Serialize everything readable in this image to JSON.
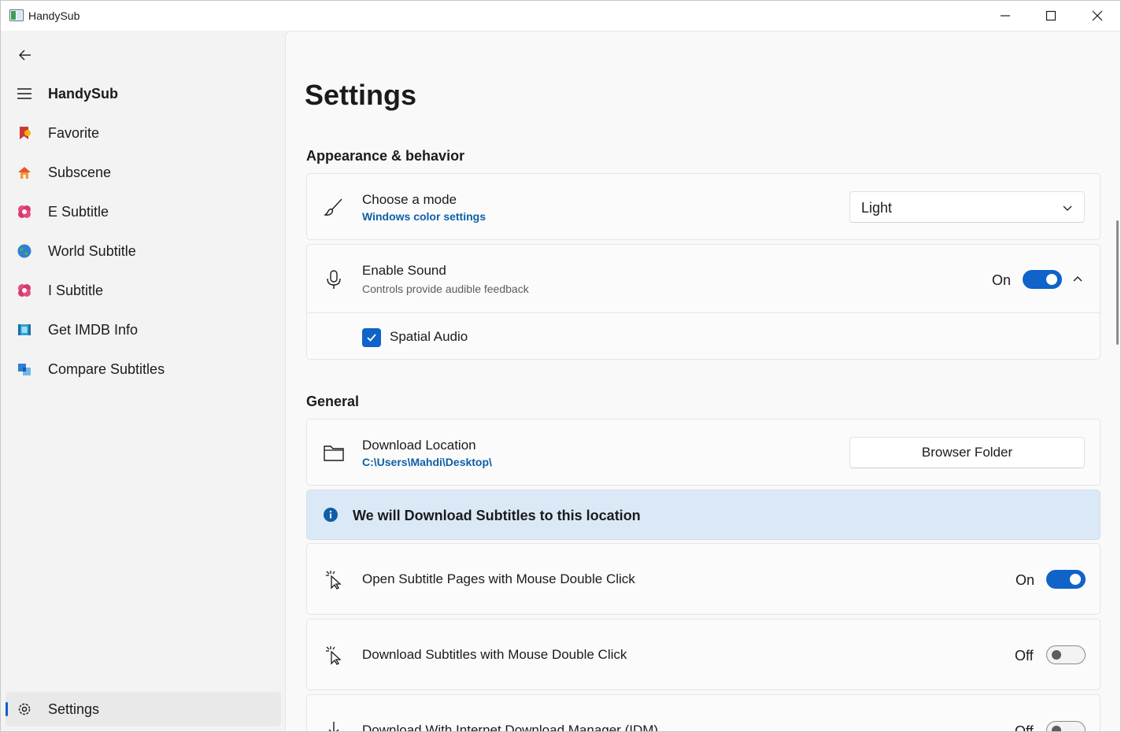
{
  "window": {
    "title": "HandySub"
  },
  "sidebar": {
    "header_label": "HandySub",
    "items": [
      {
        "label": "Favorite",
        "icon": "favorite-bookmark-icon"
      },
      {
        "label": "Subscene",
        "icon": "subscene-house-icon"
      },
      {
        "label": "E Subtitle",
        "icon": "esubtitle-icon"
      },
      {
        "label": "World Subtitle",
        "icon": "world-globe-icon"
      },
      {
        "label": "I Subtitle",
        "icon": "isubtitle-icon"
      },
      {
        "label": "Get IMDB Info",
        "icon": "film-strip-icon"
      },
      {
        "label": "Compare Subtitles",
        "icon": "compare-icon"
      }
    ],
    "settings_label": "Settings"
  },
  "main": {
    "page_title": "Settings",
    "appearance_section": "Appearance & behavior",
    "mode_card": {
      "title": "Choose a mode",
      "link": "Windows color settings",
      "dropdown_value": "Light"
    },
    "sound_card": {
      "title": "Enable Sound",
      "subtitle": "Controls provide audible feedback",
      "toggle_label": "On",
      "toggle_state": true
    },
    "spatial_audio": {
      "label": "Spatial Audio",
      "checked": true
    },
    "general_section": "General",
    "download_card": {
      "title": "Download Location",
      "path": "C:\\Users\\Mahdi\\Desktop\\",
      "button_label": "Browser Folder"
    },
    "info_bar": {
      "text": "We will Download Subtitles to this location"
    },
    "open_pages_card": {
      "title": "Open Subtitle Pages with Mouse Double Click",
      "toggle_label": "On",
      "toggle_state": true
    },
    "download_dbl_card": {
      "title": "Download Subtitles with Mouse Double Click",
      "toggle_label": "Off",
      "toggle_state": false
    },
    "idm_card": {
      "title": "Download With Internet Download Manager (IDM)",
      "toggle_label": "Off",
      "toggle_state": false
    }
  },
  "colors": {
    "accent": "#0f63c9",
    "link": "#0f5fa8",
    "info_bg": "#dbe9f7"
  }
}
